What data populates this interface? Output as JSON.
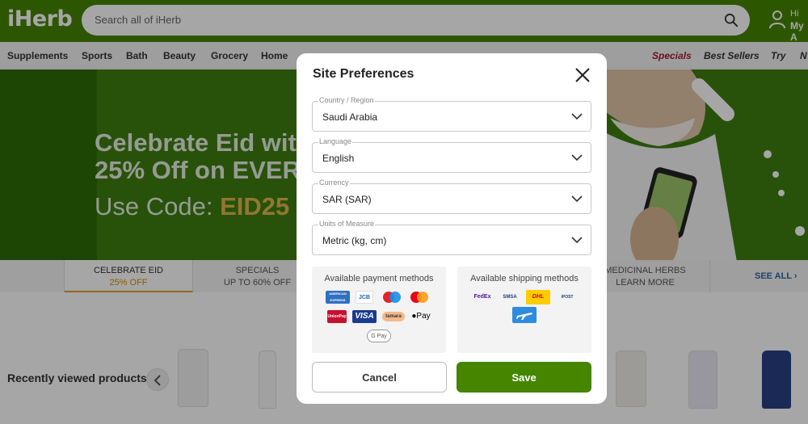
{
  "header": {
    "logo": "iHerb",
    "search_placeholder": "Search all of iHerb",
    "account_hi": "Hi",
    "account_label": "My A"
  },
  "nav": {
    "items": [
      "Supplements",
      "Sports",
      "Bath",
      "Beauty",
      "Grocery",
      "Home"
    ],
    "right_items": [
      "Specials",
      "Best Sellers",
      "Try",
      "N"
    ]
  },
  "banner": {
    "headline_line1": "Celebrate Eid with",
    "headline_line2": "25% Off on EVER",
    "code_prefix": "Use Code: ",
    "code": "EID25"
  },
  "promo_tabs": [
    {
      "title": "CELEBRATE EID",
      "sub": "25% OFF"
    },
    {
      "title": "SPECIALS",
      "sub": "UP TO 60% OFF"
    },
    {
      "title": "MEDICINAL HERBS",
      "sub": "LEARN MORE"
    }
  ],
  "see_all": "SEE ALL",
  "recently_viewed": {
    "title": "Recently viewed products"
  },
  "modal": {
    "title": "Site Preferences",
    "fields": [
      {
        "label": "Country / Region",
        "value": "Saudi Arabia"
      },
      {
        "label": "Language",
        "value": "English"
      },
      {
        "label": "Currency",
        "value": "SAR (SAR)"
      },
      {
        "label": "Units of Measure",
        "value": "Metric (kg, cm)"
      }
    ],
    "payment_title": "Available payment methods",
    "payment_methods": {
      "amex": "AMERICAN EXPRESS",
      "jcb": "JCB",
      "maestro": "maestro",
      "mastercard": "mastercard",
      "unionpay": "UnionPay",
      "visa": "VISA",
      "tamara": "tamara",
      "applepay": "Pay",
      "gpay": "G Pay"
    },
    "shipping_title": "Available shipping methods",
    "shipping_methods": {
      "fedex": "FedEx",
      "smsa": "SMSA",
      "dhl": "DHL",
      "other": "iPOST",
      "air": "air"
    },
    "cancel_label": "Cancel",
    "save_label": "Save"
  },
  "colors": {
    "brand_green": "#458500",
    "special_red": "#a6192e",
    "code_gold": "#e0b54e"
  }
}
